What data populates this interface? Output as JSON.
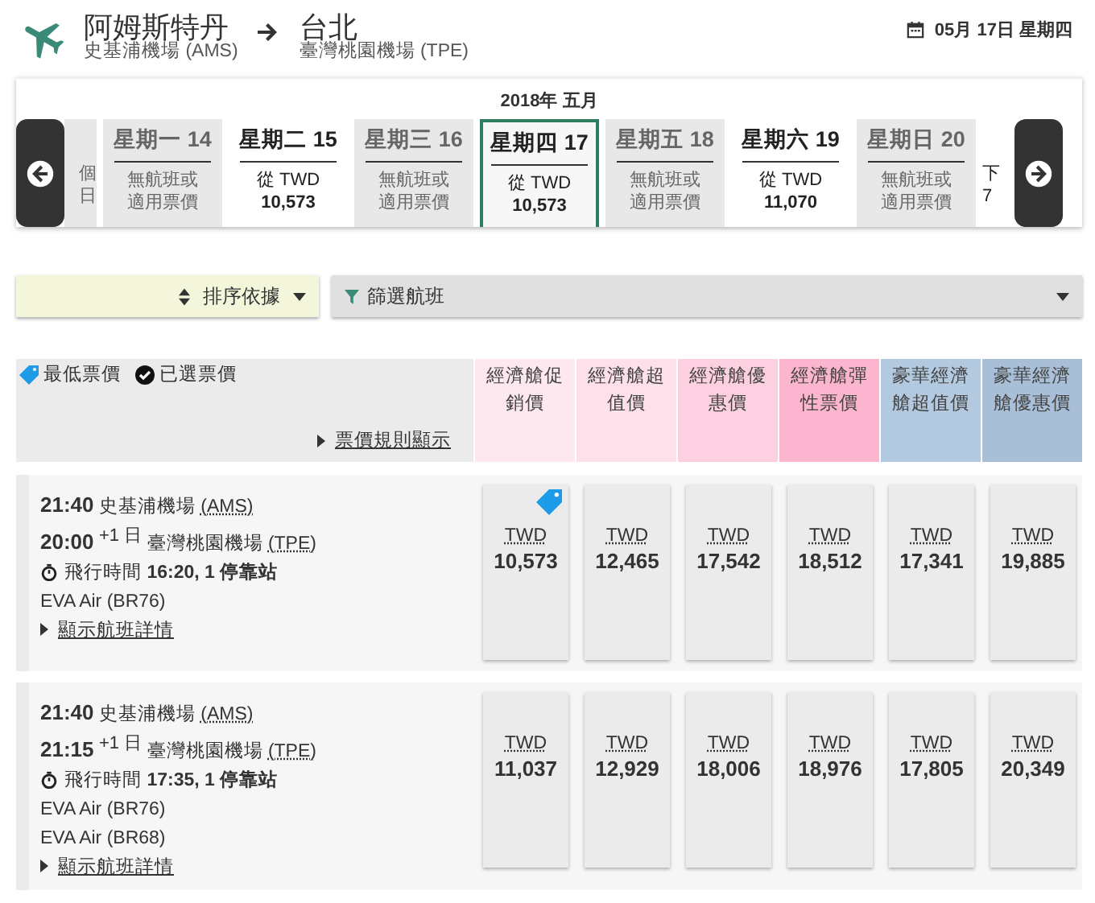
{
  "header": {
    "origin_city": "阿姆斯特丹",
    "origin_airport": "史基浦機場 (AMS)",
    "dest_city": "台北",
    "dest_airport": "臺灣桃園機場 (TPE)",
    "date": "05月 17日 星期四"
  },
  "date_strip": {
    "month": "2018年 五月",
    "days": [
      {
        "kind": "partial",
        "lines": [
          "個",
          "日"
        ],
        "available": false,
        "selected": false
      },
      {
        "kind": "day",
        "label": "星期一 14",
        "lines": [
          "無航班或",
          "適用票價"
        ],
        "available": false,
        "selected": false
      },
      {
        "kind": "day",
        "label": "星期二 15",
        "lines": [
          "從 TWD",
          "10,573"
        ],
        "available": true,
        "selected": false
      },
      {
        "kind": "day",
        "label": "星期三 16",
        "lines": [
          "無航班或",
          "適用票價"
        ],
        "available": false,
        "selected": false
      },
      {
        "kind": "day",
        "label": "星期四 17",
        "lines": [
          "從 TWD",
          "10,573"
        ],
        "available": true,
        "selected": true
      },
      {
        "kind": "day",
        "label": "星期五 18",
        "lines": [
          "無航班或",
          "適用票價"
        ],
        "available": false,
        "selected": false
      },
      {
        "kind": "day",
        "label": "星期六 19",
        "lines": [
          "從 TWD",
          "11,070"
        ],
        "available": true,
        "selected": false
      },
      {
        "kind": "day",
        "label": "星期日 20",
        "lines": [
          "無航班或",
          "適用票價"
        ],
        "available": false,
        "selected": false
      },
      {
        "kind": "partial",
        "lines": [
          "下",
          "7"
        ],
        "available": true,
        "selected": false
      }
    ]
  },
  "sort": {
    "label": "排序依據"
  },
  "filter": {
    "label": "篩選航班"
  },
  "legend": {
    "lowest": "最低票價",
    "selected": "已選票價",
    "rules_link": "票價規則顯示"
  },
  "fare_columns": [
    {
      "label": "經濟艙促銷價",
      "color": "#fde8ef"
    },
    {
      "label": "經濟艙超值價",
      "color": "#fde0ea"
    },
    {
      "label": "經濟艙優惠價",
      "color": "#fcd0e0"
    },
    {
      "label": "經濟艙彈性票價",
      "color": "#fbb5cf"
    },
    {
      "label": "豪華經濟艙超值價",
      "color": "#b3c9df"
    },
    {
      "label": "豪華經濟艙優惠價",
      "color": "#a9bfd7"
    }
  ],
  "flights": [
    {
      "depart_time": "21:40",
      "depart_airport": "史基浦機場",
      "depart_code": "(AMS)",
      "arrive_time": "20:00",
      "day_offset": "+1",
      "day_unit": "日",
      "arrive_airport": "臺灣桃園機場",
      "arrive_code": "(TPE)",
      "duration_label": "飛行時間",
      "duration": "16:20, 1 停靠站",
      "carriers": [
        "EVA Air (BR76)"
      ],
      "details_link": "顯示航班詳情",
      "fares": [
        {
          "currency": "TWD",
          "amount": "10,573",
          "lowest": true
        },
        {
          "currency": "TWD",
          "amount": "12,465",
          "lowest": false
        },
        {
          "currency": "TWD",
          "amount": "17,542",
          "lowest": false
        },
        {
          "currency": "TWD",
          "amount": "18,512",
          "lowest": false
        },
        {
          "currency": "TWD",
          "amount": "17,341",
          "lowest": false
        },
        {
          "currency": "TWD",
          "amount": "19,885",
          "lowest": false
        }
      ]
    },
    {
      "depart_time": "21:40",
      "depart_airport": "史基浦機場",
      "depart_code": "(AMS)",
      "arrive_time": "21:15",
      "day_offset": "+1",
      "day_unit": "日",
      "arrive_airport": "臺灣桃園機場",
      "arrive_code": "(TPE)",
      "duration_label": "飛行時間",
      "duration": "17:35, 1 停靠站",
      "carriers": [
        "EVA Air (BR76)",
        "EVA Air (BR68)"
      ],
      "details_link": "顯示航班詳情",
      "fares": [
        {
          "currency": "TWD",
          "amount": "11,037",
          "lowest": false
        },
        {
          "currency": "TWD",
          "amount": "12,929",
          "lowest": false
        },
        {
          "currency": "TWD",
          "amount": "18,006",
          "lowest": false
        },
        {
          "currency": "TWD",
          "amount": "18,976",
          "lowest": false
        },
        {
          "currency": "TWD",
          "amount": "17,805",
          "lowest": false
        },
        {
          "currency": "TWD",
          "amount": "20,349",
          "lowest": false
        }
      ]
    }
  ]
}
